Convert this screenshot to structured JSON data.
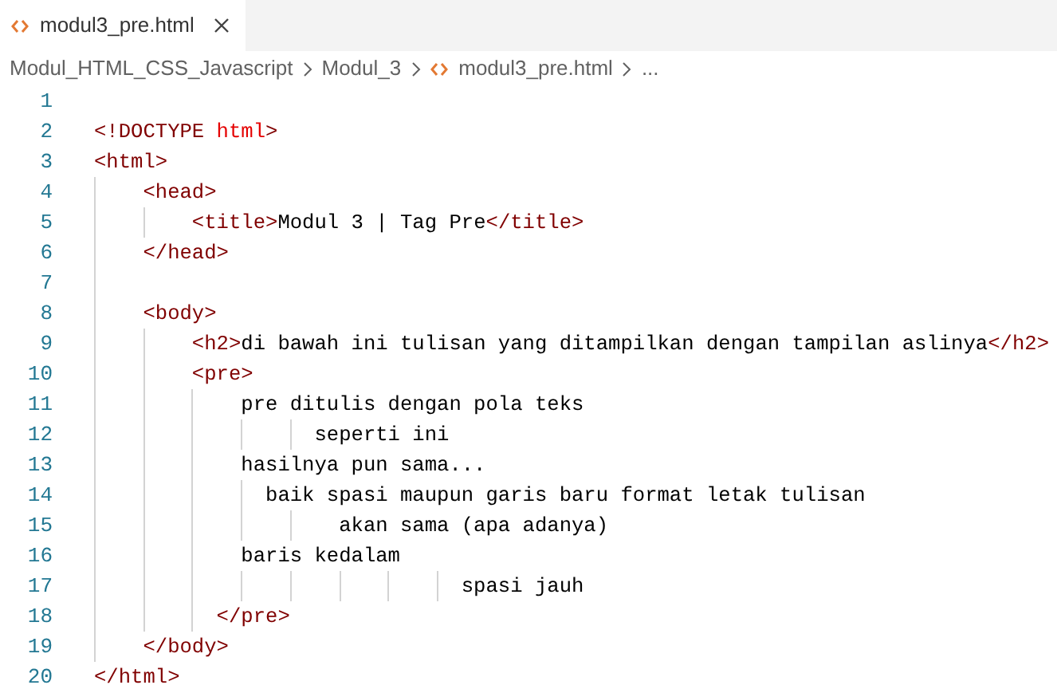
{
  "tab": {
    "title": "modul3_pre.html",
    "selected": true
  },
  "breadcrumbs": [
    {
      "kind": "folder",
      "text": "Modul_HTML_CSS_Javascript"
    },
    {
      "kind": "folder",
      "text": "Modul_3"
    },
    {
      "kind": "file",
      "text": "modul3_pre.html"
    },
    {
      "kind": "more",
      "text": "..."
    }
  ],
  "lines": [
    {
      "number": "1"
    },
    {
      "number": "2",
      "tokens": [
        {
          "kind": "tag",
          "text": "<!DOCTYPE "
        },
        {
          "kind": "keyword",
          "text": "html"
        },
        {
          "kind": "tag",
          "text": ">"
        }
      ]
    },
    {
      "number": "3",
      "tokens": [
        {
          "kind": "tag",
          "text": "<html>"
        }
      ]
    },
    {
      "number": "4",
      "tokens": [
        {
          "kind": "tag",
          "text": "    <head>"
        }
      ]
    },
    {
      "number": "5",
      "tokens": [
        {
          "kind": "tag",
          "text": "        <title>"
        },
        {
          "kind": "text",
          "text": "Modul 3 | Tag Pre"
        },
        {
          "kind": "tag",
          "text": "</title>"
        }
      ]
    },
    {
      "number": "6",
      "tokens": [
        {
          "kind": "tag",
          "text": "    </head>"
        }
      ]
    },
    {
      "number": "7"
    },
    {
      "number": "8",
      "tokens": [
        {
          "kind": "tag",
          "text": "    <body>"
        }
      ]
    },
    {
      "number": "9",
      "tokens": [
        {
          "kind": "tag",
          "text": "        <h2>"
        },
        {
          "kind": "text",
          "text": "di bawah ini tulisan yang ditampilkan dengan tampilan aslinya"
        },
        {
          "kind": "tag",
          "text": "</h2>"
        }
      ]
    },
    {
      "number": "10",
      "tokens": [
        {
          "kind": "tag",
          "text": "        <pre>"
        }
      ]
    },
    {
      "number": "11",
      "tokens": [
        {
          "kind": "text",
          "text": "            pre ditulis dengan pola teks"
        }
      ]
    },
    {
      "number": "12",
      "tokens": [
        {
          "kind": "text",
          "text": "                  seperti ini"
        }
      ]
    },
    {
      "number": "13",
      "tokens": [
        {
          "kind": "text",
          "text": "            hasilnya pun sama..."
        }
      ]
    },
    {
      "number": "14",
      "tokens": [
        {
          "kind": "text",
          "text": "              baik spasi maupun garis baru format letak tulisan"
        }
      ]
    },
    {
      "number": "15",
      "tokens": [
        {
          "kind": "text",
          "text": "                    akan sama (apa adanya)"
        }
      ]
    },
    {
      "number": "16",
      "tokens": [
        {
          "kind": "text",
          "text": "            baris kedalam"
        }
      ]
    },
    {
      "number": "17",
      "tokens": [
        {
          "kind": "text",
          "text": "                              spasi jauh"
        }
      ]
    },
    {
      "number": "18",
      "tokens": [
        {
          "kind": "tag",
          "text": "          </pre>"
        }
      ]
    },
    {
      "number": "19",
      "tokens": [
        {
          "kind": "tag",
          "text": "    </body>"
        }
      ]
    },
    {
      "number": "20",
      "tokens": [
        {
          "kind": "tag",
          "text": "</html>"
        }
      ]
    }
  ]
}
